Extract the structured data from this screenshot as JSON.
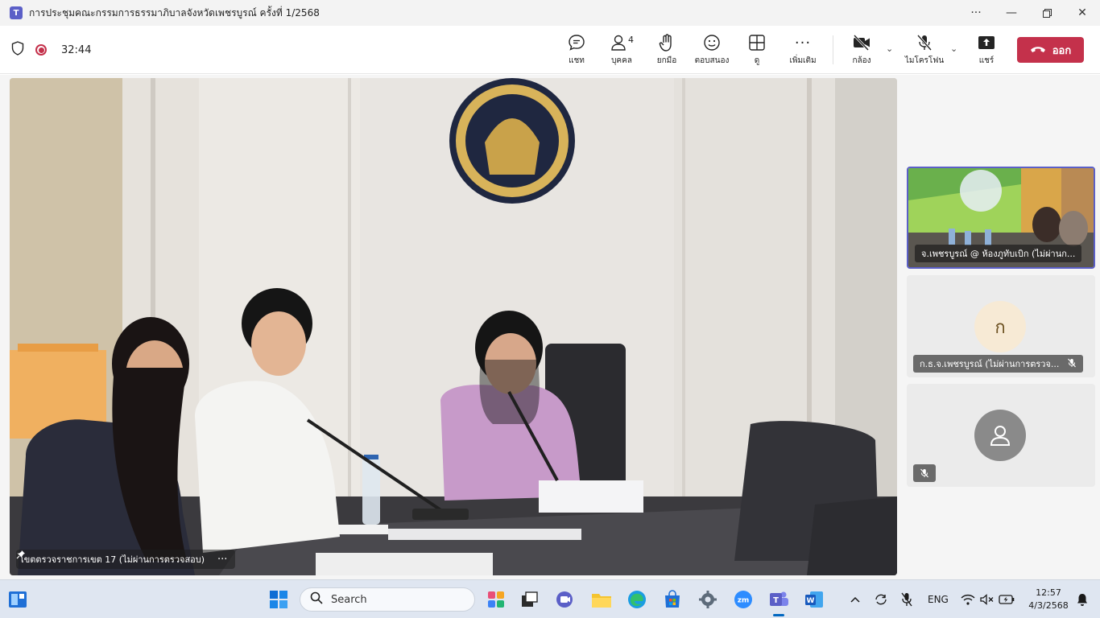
{
  "window": {
    "title": "การประชุมคณะกรรมการธรรมาภิบาลจังหวัดเพชรบูรณ์ ครั้งที่ 1/2568"
  },
  "meeting": {
    "elapsed": "32:44"
  },
  "toolbar": {
    "chat": "แชท",
    "people": "บุคคล",
    "people_count": "4",
    "raise": "ยกมือ",
    "react": "ตอบสนอง",
    "view": "ดู",
    "more": "เพิ่มเติม",
    "camera": "กล้อง",
    "mic": "ไมโครโฟน",
    "share": "แชร์",
    "leave": "ออก"
  },
  "main_video": {
    "name": "เขตตรวจราชการเขต 17 (ไม่ผ่านการตรวจสอบ)"
  },
  "participants": [
    {
      "name": "จ.เพชรบูรณ์ @ ห้องภูทับเบิก (ไม่ผ่านก..."
    },
    {
      "initial": "ก",
      "name": "ก.ธ.จ.เพชรบูรณ์ (ไม่ผ่านการตรวจ..."
    },
    {
      "name": ""
    }
  ],
  "taskbar": {
    "search_label": "Search",
    "language": "ENG",
    "time": "12:57",
    "date": "4/3/2568"
  },
  "colors": {
    "accent": "#5b5fc7",
    "leave": "#c4314b"
  }
}
